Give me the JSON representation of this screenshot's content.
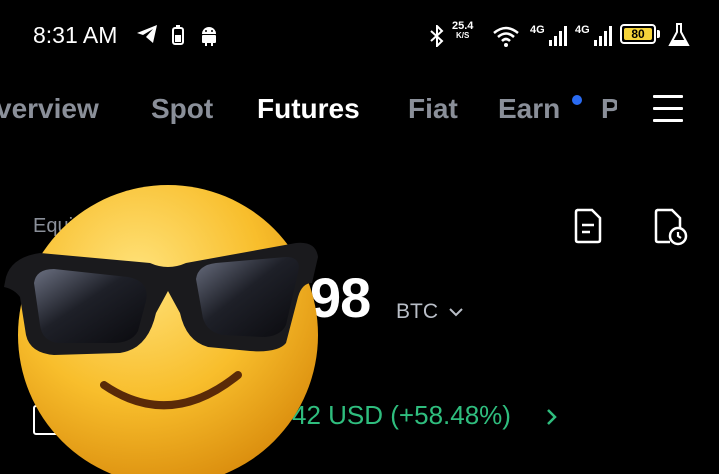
{
  "status_bar": {
    "time": "8:31 AM",
    "net_speed_value": "25.4",
    "net_speed_unit": "K/S",
    "signal_1": "4G",
    "signal_2": "4G",
    "battery": "80"
  },
  "tabs": [
    {
      "label": "verview",
      "active": false
    },
    {
      "label": "Spot",
      "active": false
    },
    {
      "label": "Futures",
      "active": true
    },
    {
      "label": "Fiat",
      "active": false
    },
    {
      "label": "Earn",
      "active": false,
      "has_dot": true
    },
    {
      "label": "P",
      "active": false
    }
  ],
  "account": {
    "equity_label": "Equi",
    "balance_visible": "98",
    "unit": "BTC",
    "pnl": "42 USD (+58.48%)"
  },
  "icons": {
    "orders": "document-icon",
    "history": "clock-document-icon",
    "menu": "hamburger-icon",
    "overlay": "sunglasses-emoji"
  },
  "colors": {
    "background": "#000000",
    "active_tab": "#ffffff",
    "inactive_tab": "#8a8f99",
    "positive": "#2fbd7e",
    "notification_dot": "#2a6bf2",
    "battery": "#f5d43a"
  }
}
